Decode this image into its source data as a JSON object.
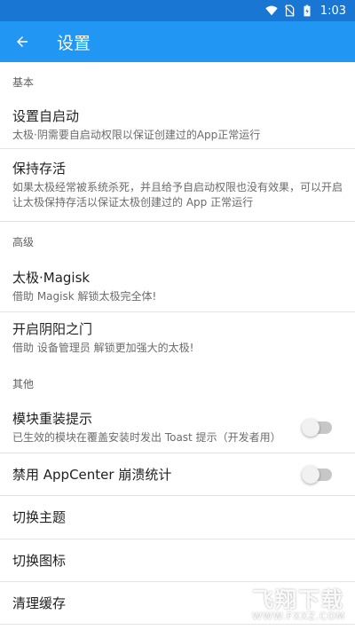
{
  "status_bar": {
    "time": "1:03",
    "icons": [
      "wifi-icon",
      "no-sim-icon",
      "battery-icon"
    ]
  },
  "toolbar": {
    "title": "设置",
    "back_icon": "arrow-back-icon"
  },
  "sections": {
    "basic": {
      "header": "基本"
    },
    "advanced": {
      "header": "高级"
    },
    "other": {
      "header": "其他"
    }
  },
  "prefs": {
    "auto_start": {
      "title": "设置自启动",
      "summary": "太极·阴需要自启动权限以保证创建过的App正常运行"
    },
    "keep_alive": {
      "title": "保持存活",
      "summary": "如果太极经常被系统杀死，并且给予自启动权限也没有效果，可以开启让太极保持存活以保证太极创建过的 App 正常运行"
    },
    "magisk": {
      "title": "太极·Magisk",
      "summary": "借助 Magisk 解锁太极完全体!"
    },
    "yinyang": {
      "title": "开启阴阳之门",
      "summary": "借助 设备管理员 解锁更加强大的太极!"
    },
    "reinstall_tip": {
      "title": "模块重装提示",
      "summary": "已生效的模块在覆盖安装时发出 Toast 提示（开发者用）",
      "enabled": false
    },
    "appcenter": {
      "title": "禁用 AppCenter 崩溃统计",
      "enabled": false
    },
    "theme": {
      "title": "切换主题"
    },
    "icon": {
      "title": "切换图标"
    },
    "cache": {
      "title": "清理缓存"
    }
  },
  "watermark": {
    "text": "飞翔下载",
    "url": "WWW.FXXZ.COM"
  },
  "colors": {
    "status_bar": "#1976d2",
    "toolbar": "#2196f3",
    "divider": "#e3e3e3"
  }
}
